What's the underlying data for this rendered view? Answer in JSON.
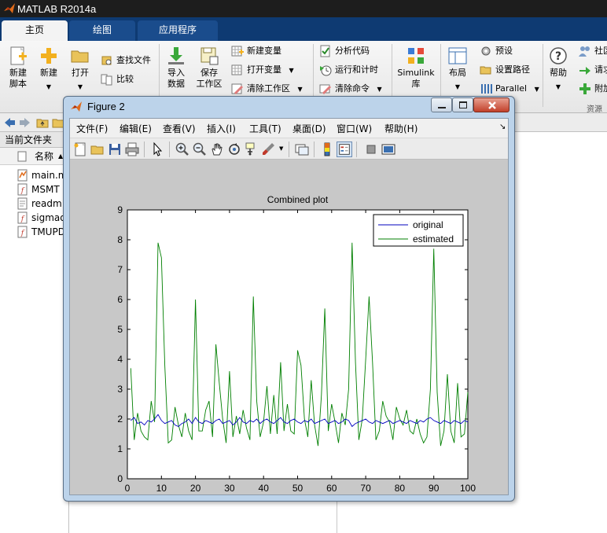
{
  "app": {
    "title": "MATLAB R2014a"
  },
  "tabs": [
    {
      "label": "主页",
      "active": true
    },
    {
      "label": "绘图",
      "active": false
    },
    {
      "label": "应用程序",
      "active": false
    }
  ],
  "ribbon": {
    "new_script": "新建\n脚本",
    "new": "新建",
    "open": "打开",
    "find_files": "查找文件",
    "compare": "比较",
    "import_data": "导入\n数据",
    "save_workspace": "保存\n工作区",
    "new_variable": "新建变量",
    "open_variable": "打开变量",
    "clear_workspace": "清除工作区",
    "analyze_code": "分析代码",
    "run_and_time": "运行和计时",
    "clear_commands": "清除命令",
    "simulink": "Simulink\n库",
    "layout": "布局",
    "preferences": "预设",
    "set_path": "设置路径",
    "parallel": "Parallel",
    "help": "帮助",
    "community": "社区",
    "request_support": "请求",
    "addons": "附加",
    "resources_group": "资源"
  },
  "file_browser": {
    "title": "当前文件夹",
    "col_name": "名称",
    "files": [
      {
        "name": "main.m",
        "icon": "m-file-icon"
      },
      {
        "name": "MSMT",
        "icon": "function-file-icon"
      },
      {
        "name": "readm",
        "icon": "text-file-icon"
      },
      {
        "name": "sigmad",
        "icon": "function-file-icon"
      },
      {
        "name": "TMUPD",
        "icon": "function-file-icon"
      }
    ]
  },
  "figure": {
    "title": "Figure 2",
    "menus": [
      "文件(F)",
      "编辑(E)",
      "查看(V)",
      "插入(I)",
      "工具(T)",
      "桌面(D)",
      "窗口(W)",
      "帮助(H)"
    ],
    "toolbar_icons": [
      "new-figure-icon",
      "open-file-icon",
      "save-icon",
      "print-icon",
      "pointer-icon",
      "zoom-in-icon",
      "zoom-out-icon",
      "pan-icon",
      "rotate-icon",
      "data-cursor-icon",
      "brush-icon",
      "link-plot-icon",
      "colorbar-icon",
      "legend-icon",
      "hide-plot-tools-icon",
      "show-plot-tools-icon"
    ]
  },
  "chart_data": {
    "type": "line",
    "title": "Combined plot",
    "xlabel": "",
    "ylabel": "",
    "xlim": [
      0,
      100
    ],
    "ylim": [
      0,
      9
    ],
    "xticks": [
      0,
      10,
      20,
      30,
      40,
      50,
      60,
      70,
      80,
      90,
      100
    ],
    "yticks": [
      0,
      1,
      2,
      3,
      4,
      5,
      6,
      7,
      8,
      9
    ],
    "legend": {
      "position": "top-right",
      "entries": [
        "original",
        "estimated"
      ]
    },
    "grid": false,
    "series": [
      {
        "name": "original",
        "color": "#0000bf",
        "x": [
          1,
          2,
          3,
          4,
          5,
          6,
          7,
          8,
          9,
          10,
          11,
          12,
          13,
          14,
          15,
          16,
          17,
          18,
          19,
          20,
          21,
          22,
          23,
          24,
          25,
          26,
          27,
          28,
          29,
          30,
          31,
          32,
          33,
          34,
          35,
          36,
          37,
          38,
          39,
          40,
          41,
          42,
          43,
          44,
          45,
          46,
          47,
          48,
          49,
          50,
          51,
          52,
          53,
          54,
          55,
          56,
          57,
          58,
          59,
          60,
          61,
          62,
          63,
          64,
          65,
          66,
          67,
          68,
          69,
          70,
          71,
          72,
          73,
          74,
          75,
          76,
          77,
          78,
          79,
          80,
          81,
          82,
          83,
          84,
          85,
          86,
          87,
          88,
          89,
          90,
          91,
          92,
          93,
          94,
          95,
          96,
          97,
          98,
          99,
          100
        ],
        "values": [
          1.95,
          2.05,
          1.85,
          1.9,
          1.8,
          1.95,
          1.9,
          2.0,
          2.15,
          1.95,
          1.85,
          1.9,
          1.95,
          1.8,
          1.75,
          1.85,
          1.9,
          2.0,
          1.85,
          2.05,
          1.9,
          1.85,
          1.95,
          1.9,
          1.85,
          1.95,
          2.0,
          1.85,
          1.9,
          1.95,
          1.8,
          1.9,
          2.05,
          1.9,
          1.85,
          1.95,
          1.9,
          2.0,
          1.85,
          1.95,
          2.0,
          1.9,
          1.85,
          1.95,
          2.05,
          1.9,
          1.85,
          1.95,
          2.0,
          1.9,
          1.85,
          1.95,
          1.9,
          2.0,
          1.85,
          1.9,
          1.95,
          2.0,
          1.85,
          1.9,
          1.95,
          1.85,
          1.9,
          2.0,
          1.95,
          1.75,
          1.85,
          1.9,
          1.95,
          2.0,
          1.9,
          1.85,
          1.95,
          1.9,
          1.85,
          1.9,
          1.95,
          1.85,
          1.9,
          1.95,
          1.9,
          1.85,
          1.95,
          1.9,
          1.85,
          1.95,
          1.9,
          2.0,
          2.05,
          1.95,
          1.9,
          1.85,
          1.95,
          1.9,
          1.85,
          1.95,
          1.9,
          1.85,
          1.95,
          1.9
        ]
      },
      {
        "name": "estimated",
        "color": "#007f00",
        "x": [
          1,
          2,
          3,
          4,
          5,
          6,
          7,
          8,
          9,
          10,
          11,
          12,
          13,
          14,
          15,
          16,
          17,
          18,
          19,
          20,
          21,
          22,
          23,
          24,
          25,
          26,
          27,
          28,
          29,
          30,
          31,
          32,
          33,
          34,
          35,
          36,
          37,
          38,
          39,
          40,
          41,
          42,
          43,
          44,
          45,
          46,
          47,
          48,
          49,
          50,
          51,
          52,
          53,
          54,
          55,
          56,
          57,
          58,
          59,
          60,
          61,
          62,
          63,
          64,
          65,
          66,
          67,
          68,
          69,
          70,
          71,
          72,
          73,
          74,
          75,
          76,
          77,
          78,
          79,
          80,
          81,
          82,
          83,
          84,
          85,
          86,
          87,
          88,
          89,
          90,
          91,
          92,
          93,
          94,
          95,
          96,
          97,
          98,
          99,
          100
        ],
        "values": [
          3.7,
          1.3,
          2.2,
          1.6,
          1.4,
          1.3,
          2.6,
          1.9,
          7.9,
          7.4,
          3.8,
          1.2,
          1.3,
          2.4,
          1.8,
          1.4,
          2.2,
          1.6,
          1.3,
          6.0,
          1.6,
          1.6,
          2.3,
          2.6,
          1.4,
          4.5,
          3.2,
          2.0,
          1.2,
          3.6,
          1.4,
          2.1,
          1.5,
          2.3,
          1.7,
          1.3,
          6.1,
          2.6,
          1.4,
          1.9,
          3.1,
          1.5,
          2.8,
          1.5,
          3.9,
          1.6,
          2.5,
          1.6,
          1.5,
          4.3,
          3.8,
          2.0,
          1.4,
          3.3,
          1.8,
          1.1,
          2.8,
          5.7,
          1.6,
          2.5,
          1.9,
          1.2,
          2.2,
          1.8,
          3.0,
          7.9,
          3.9,
          1.3,
          2.0,
          4.0,
          6.1,
          3.9,
          1.3,
          1.6,
          2.6,
          2.1,
          1.9,
          1.3,
          2.4,
          2.0,
          1.8,
          2.3,
          1.6,
          1.5,
          2.0,
          1.5,
          1.2,
          1.4,
          3.0,
          7.7,
          2.9,
          1.1,
          1.6,
          3.5,
          1.6,
          1.2,
          3.2,
          1.4,
          1.5,
          2.9
        ]
      }
    ]
  }
}
